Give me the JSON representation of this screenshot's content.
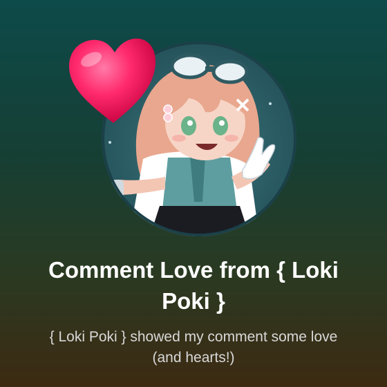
{
  "notification": {
    "title": "Comment Love from { Loki Poki }",
    "message": "{ Loki Poki } showed my comment some love (and hearts!)"
  },
  "icons": {
    "avatar": "profile-avatar",
    "heart": "heart-icon"
  },
  "colors": {
    "background_top": "#0d4a4a",
    "background_bottom": "#3d2a12",
    "heart": "#ff2a6d",
    "title": "#ffffff",
    "subtitle": "#d8d8d8"
  }
}
